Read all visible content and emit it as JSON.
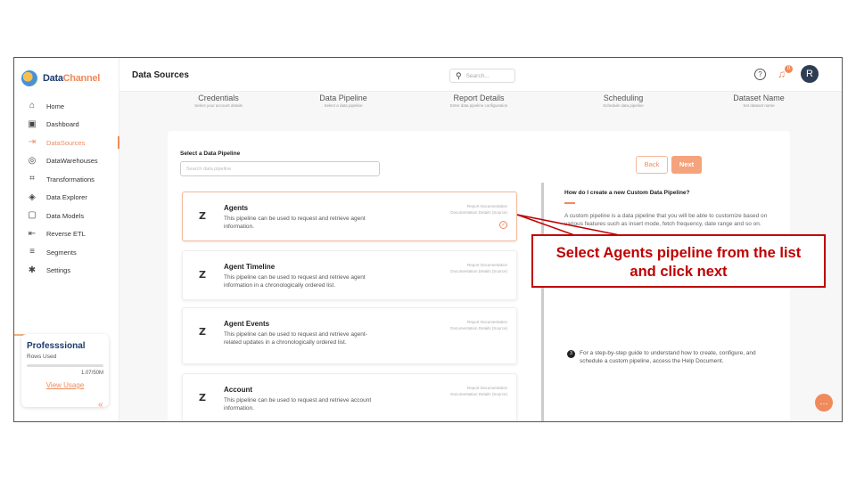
{
  "app": {
    "logo_text_1": "Data",
    "logo_text_2": "Channel"
  },
  "sidebar": {
    "items": [
      {
        "label": "Home",
        "icon": "home-icon"
      },
      {
        "label": "Dashboard",
        "icon": "dashboard-icon"
      },
      {
        "label": "DataSources",
        "icon": "datasources-icon",
        "active": true
      },
      {
        "label": "DataWarehouses",
        "icon": "warehouse-icon"
      },
      {
        "label": "Transformations",
        "icon": "transform-icon"
      },
      {
        "label": "Data Explorer",
        "icon": "explorer-icon"
      },
      {
        "label": "Data Models",
        "icon": "models-icon"
      },
      {
        "label": "Reverse ETL",
        "icon": "reverse-etl-icon"
      },
      {
        "label": "Segments",
        "icon": "segments-icon"
      },
      {
        "label": "Settings",
        "icon": "settings-icon"
      }
    ],
    "plan": {
      "name": "Professsional",
      "rows_label": "Rows Used",
      "count": "1.07/50M",
      "link": "View Usage"
    },
    "collapse": "«"
  },
  "header": {
    "title": "Data Sources",
    "search_placeholder": "Search...",
    "notification_count": "0",
    "avatar_initial": "R"
  },
  "steps": [
    {
      "title": "Credentials",
      "sub": "Select your account details"
    },
    {
      "title": "Data Pipeline",
      "sub": "Select a data pipeline"
    },
    {
      "title": "Report Details",
      "sub": "Enter data pipeline configuration"
    },
    {
      "title": "Scheduling",
      "sub": "Schedule data pipeline"
    },
    {
      "title": "Dataset Name",
      "sub": "Set dataset name"
    }
  ],
  "main": {
    "select_label": "Select a Data Pipeline",
    "search_placeholder": "Search data pipeline",
    "back_label": "Back",
    "next_label": "Next",
    "pipelines": [
      {
        "title": "Agents",
        "desc": "This pipeline can be used to request and retrieve agent information.",
        "link1": "Report Documentation",
        "link2": "Documentation Details (Source)",
        "selected": true
      },
      {
        "title": "Agent Timeline",
        "desc": "This pipeline can be used to request and retrieve agent information in a chronologically ordered list.",
        "link1": "Report Documentation",
        "link2": "Documentation Details (Source)"
      },
      {
        "title": "Agent Events",
        "desc": "This pipeline can be used to request and retrieve agent-related updates in a chronologically ordered list.",
        "link1": "Report Documentation",
        "link2": "Documentation Details (Source)"
      },
      {
        "title": "Account",
        "desc": "This pipeline can be used to request and retrieve account information.",
        "link1": "Report Documentation",
        "link2": "Documentation Details (Source)"
      }
    ],
    "help": {
      "question": "How do I create a new Custom Data Pipeline?",
      "paragraph": "A custom pipeline is a data pipeline that you will be able to customize based on various features such as insert mode, fetch frequency, date range and so on.",
      "step_number": "3",
      "step_text": "For a step-by-step guide to understand how to create, configure, and schedule a custom pipeline, access the Help Document."
    }
  },
  "annotation": {
    "line1": "Select Agents pipeline from the list",
    "line2": "and click next"
  },
  "colors": {
    "accent": "#f08a5d",
    "callout": "#c00000"
  }
}
